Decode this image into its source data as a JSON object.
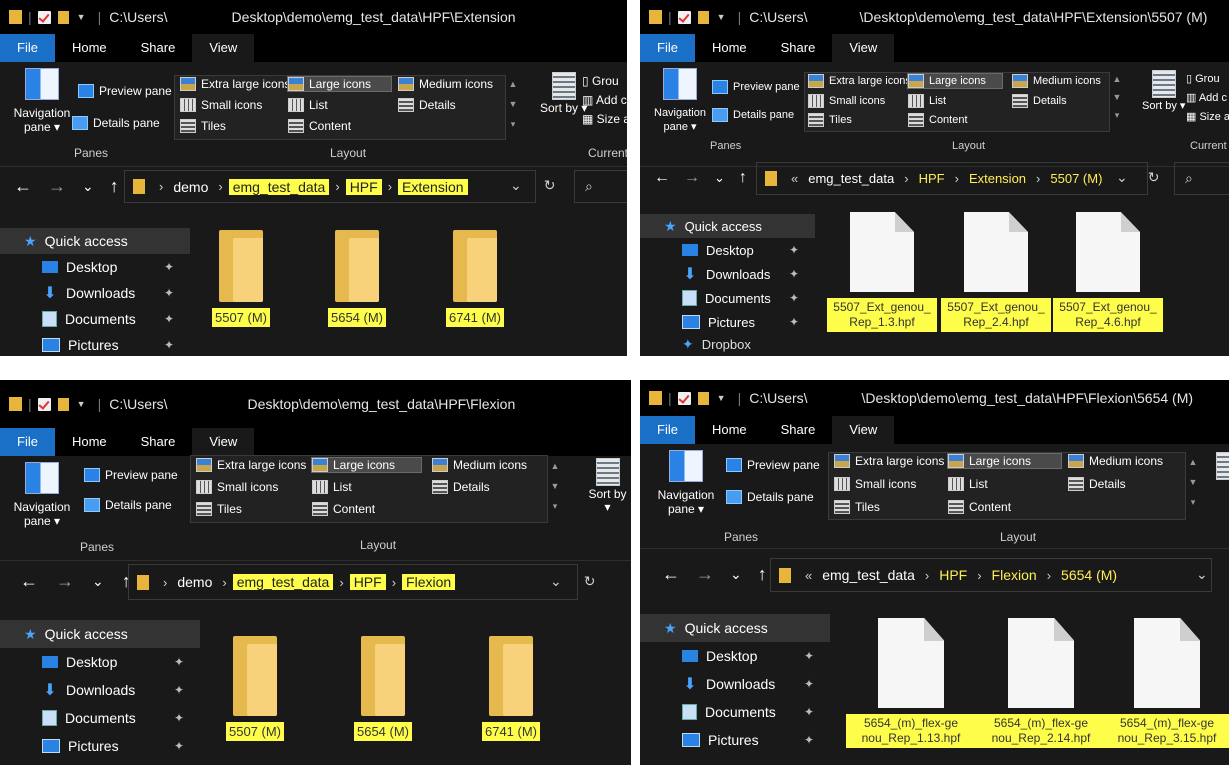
{
  "panes": [
    {
      "title_left": "C:\\Users\\",
      "title_right": "Desktop\\demo\\emg_test_data\\HPF\\Extension",
      "tabs": [
        "File",
        "Home",
        "Share",
        "View"
      ],
      "crumbs": [
        "demo",
        "emg_test_data",
        "HPF",
        "Extension"
      ],
      "items": [
        "5507 (M)",
        "5654 (M)",
        "6741 (M)"
      ]
    },
    {
      "title_left": "C:\\Users\\",
      "title_right": "\\Desktop\\demo\\emg_test_data\\HPF\\Extension\\5507 (M)",
      "tabs": [
        "File",
        "Home",
        "Share",
        "View"
      ],
      "crumbs": [
        "«",
        "emg_test_data",
        "HPF",
        "Extension",
        "5507 (M)"
      ],
      "items": [
        "5507_Ext_genou_ Rep_1.3.hpf",
        "5507_Ext_genou_ Rep_2.4.hpf",
        "5507_Ext_genou_ Rep_4.6.hpf"
      ]
    },
    {
      "title_left": "C:\\Users\\",
      "title_right": "Desktop\\demo\\emg_test_data\\HPF\\Flexion",
      "tabs": [
        "File",
        "Home",
        "Share",
        "View"
      ],
      "crumbs": [
        "demo",
        "emg_test_data",
        "HPF",
        "Flexion"
      ],
      "items": [
        "5507 (M)",
        "5654 (M)",
        "6741 (M)"
      ]
    },
    {
      "title_left": "C:\\Users\\",
      "title_right": "\\Desktop\\demo\\emg_test_data\\HPF\\Flexion\\5654 (M)",
      "tabs": [
        "File",
        "Home",
        "Share",
        "View"
      ],
      "crumbs": [
        "«",
        "emg_test_data",
        "HPF",
        "Flexion",
        "5654 (M)"
      ],
      "items": [
        "5654_(m)_flex-ge nou_Rep_1.13.hpf",
        "5654_(m)_flex-ge nou_Rep_2.14.hpf",
        "5654_(m)_flex-ge nou_Rep_3.15.hpf"
      ]
    }
  ],
  "ribbon": {
    "navigation_pane": "Navigation pane",
    "preview_pane": "Preview pane",
    "details_pane": "Details pane",
    "panes_label": "Panes",
    "layout_label": "Layout",
    "current_label": "Current",
    "extra_large_icons": "Extra large icons",
    "large_icons": "Large icons",
    "medium_icons": "Medium icons",
    "small_icons": "Small icons",
    "list": "List",
    "details": "Details",
    "tiles": "Tiles",
    "content": "Content",
    "sort_by": "Sort by",
    "group": "Grou",
    "add": "Add c",
    "size": "Size a"
  },
  "sidebar": {
    "quick_access": "Quick access",
    "desktop": "Desktop",
    "downloads": "Downloads",
    "documents": "Documents",
    "pictures": "Pictures",
    "dropbox": "Dropbox"
  },
  "icons": {
    "back": "←",
    "forward": "→",
    "recent": "⌄",
    "up": "↑",
    "refresh": "↻",
    "search": "⌕",
    "pin": "📌"
  }
}
